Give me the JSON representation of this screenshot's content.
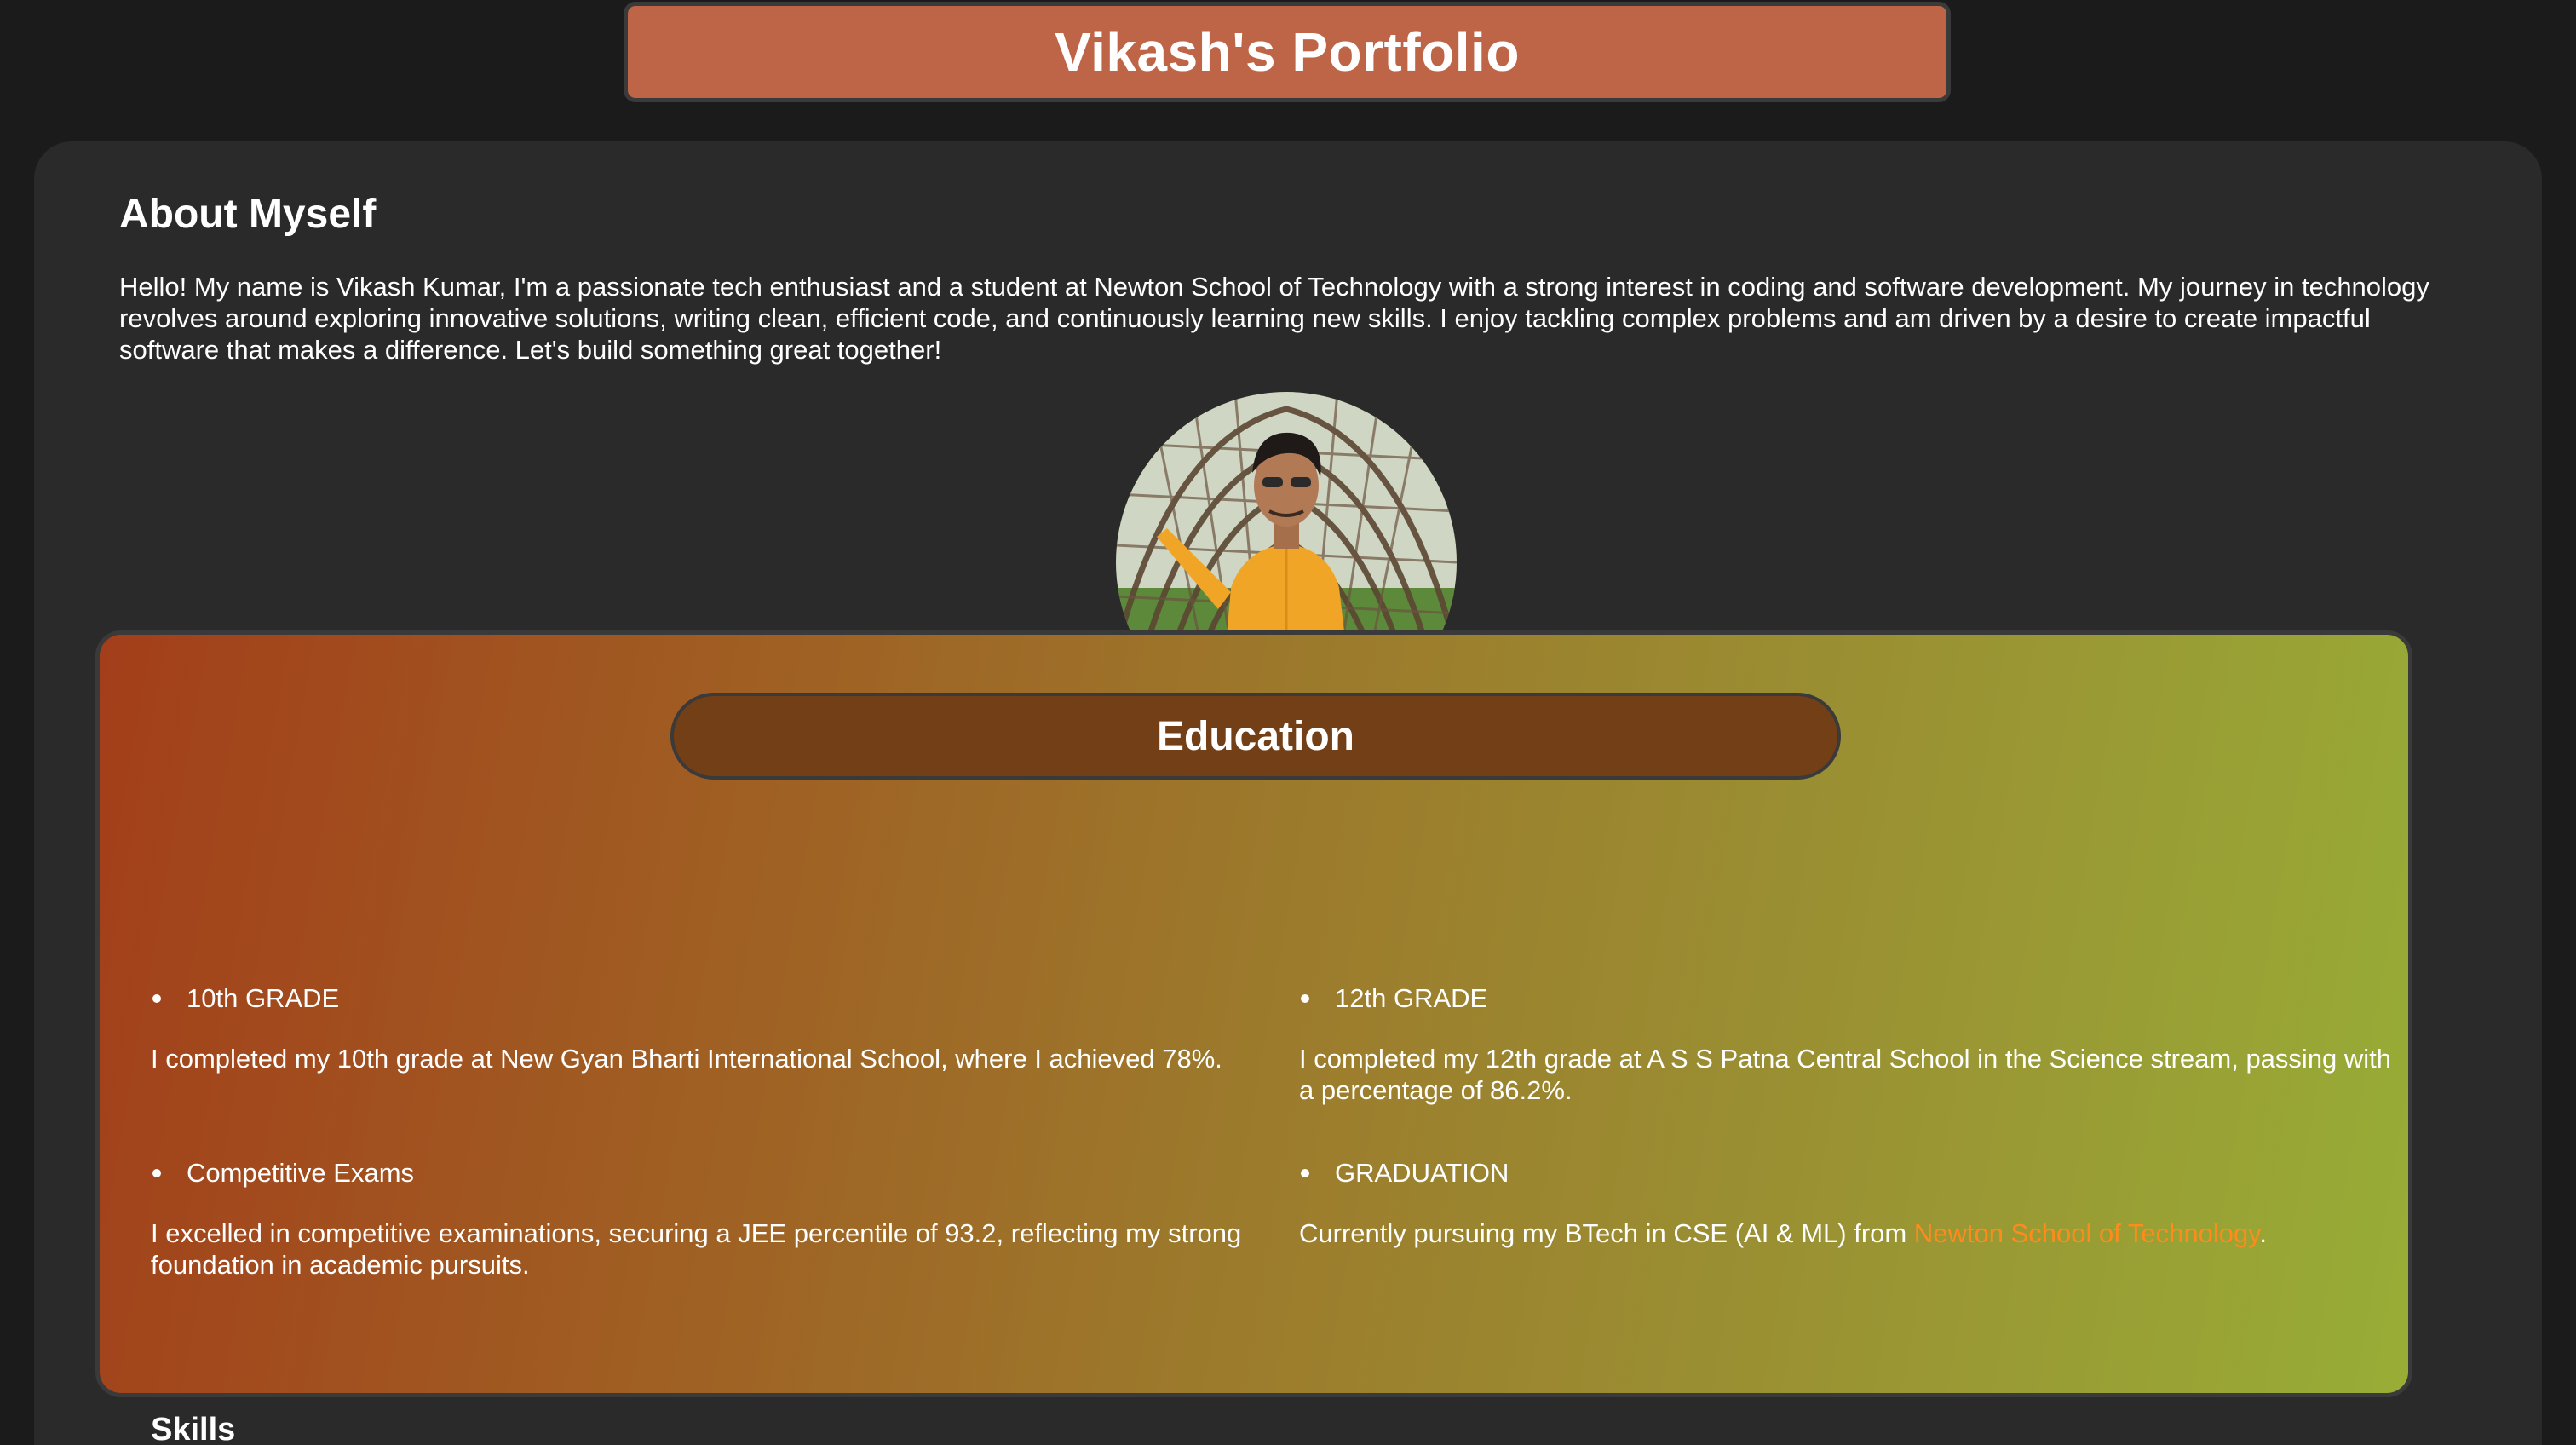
{
  "header": {
    "title": "Vikash's Portfolio"
  },
  "about": {
    "heading": "About Myself",
    "text": "Hello! My name is Vikash Kumar, I'm a passionate tech enthusiast and a student at Newton School of Technology with a strong interest in coding and software development. My journey in technology revolves around exploring innovative solutions, writing clean, efficient code, and continuously learning new skills. I enjoy tackling complex problems and am driven by a desire to create impactful software that makes a difference. Let's build something great together!"
  },
  "profile_photo": {
    "icon": "profile-photo"
  },
  "education": {
    "heading": "Education",
    "items": [
      {
        "title": "10th GRADE",
        "text": "I completed my 10th grade at New Gyan Bharti International School, where I achieved 78%."
      },
      {
        "title": "12th GRADE",
        "text": "I completed my 12th grade at A S S Patna Central School in the Science stream, passing with a percentage of 86.2%."
      },
      {
        "title": "Competitive Exams",
        "text": "I excelled in competitive examinations, securing a JEE percentile of 93.2, reflecting my strong foundation in academic pursuits."
      },
      {
        "title": "GRADUATION",
        "text_before": "Currently pursuing my BTech in CSE (AI & ML) from ",
        "link_text": "Newton School of Technology",
        "text_after": "."
      }
    ]
  },
  "skills": {
    "heading": "Skills"
  },
  "colors": {
    "background": "#1b1b1b",
    "card": "#2a2a2a",
    "header_bar": "#be6547",
    "education_pill": "#733f16",
    "link": "#ff8c1a",
    "gradient_start": "#a33e1a",
    "gradient_end": "#98ad36"
  }
}
